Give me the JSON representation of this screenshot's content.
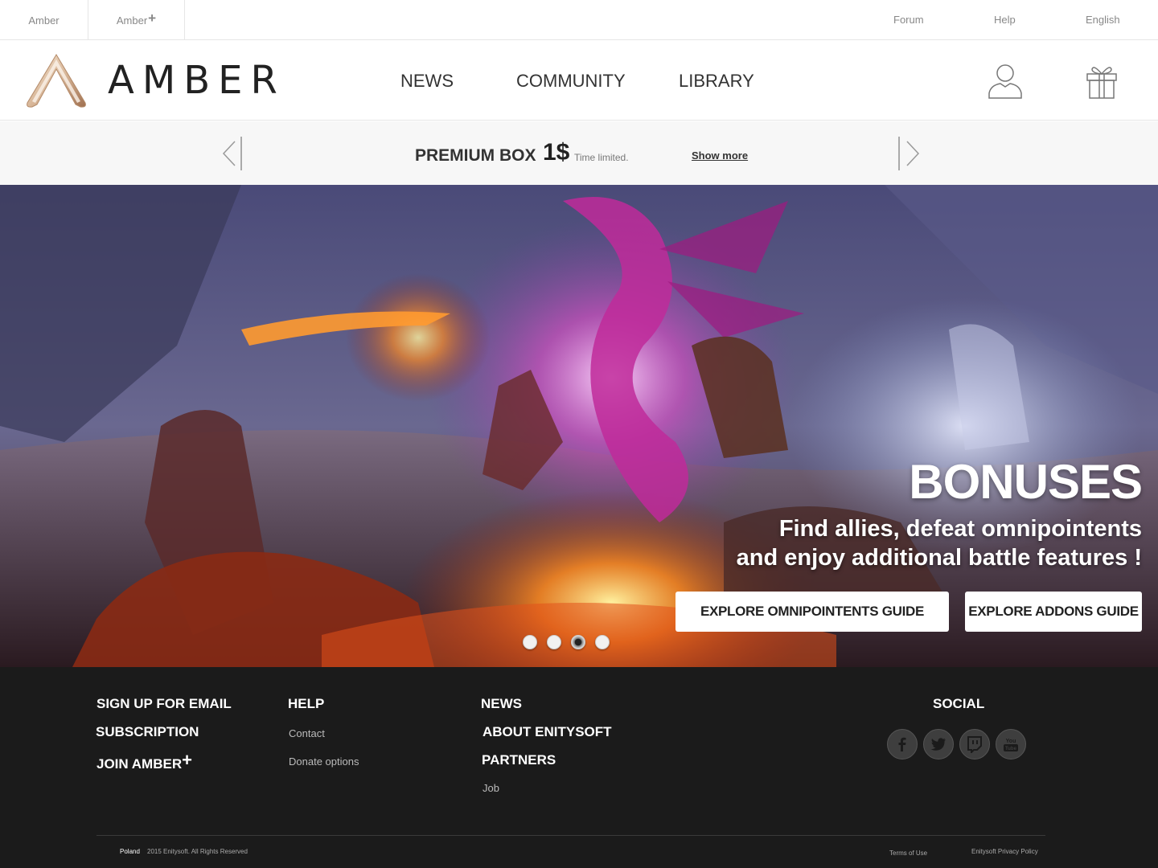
{
  "topbar": {
    "tab1": "Amber",
    "tab2": "Amber",
    "tab2_plus": "+",
    "links": [
      "Forum",
      "Help",
      "English"
    ]
  },
  "header": {
    "logo_text": "AMBER",
    "nav": [
      "NEWS",
      "COMMUNITY",
      "LIBRARY"
    ],
    "icons": [
      "user-icon",
      "gift-icon"
    ]
  },
  "promo": {
    "title": "PREMIUM BOX",
    "price": "1$",
    "subtitle": "Time limited.",
    "link": "Show more"
  },
  "hero": {
    "title": "BONUSES",
    "line1": "Find allies, defeat omnipointents",
    "line2": "and enjoy additional battle features !",
    "button1": "EXPLORE OMNIPOINTENTS GUIDE",
    "button2": "EXPLORE ADDONS GUIDE",
    "slides": 4,
    "active_slide": 3
  },
  "footer": {
    "col1": [
      "SIGN UP FOR EMAIL",
      "SUBSCRIPTION",
      "JOIN AMBER"
    ],
    "col1_plus": "+",
    "help_title": "HELP",
    "help_links": [
      "Contact",
      "Donate options"
    ],
    "col3": [
      "NEWS",
      "ABOUT ENITYSOFT",
      "PARTNERS"
    ],
    "col3_link": "Job",
    "social_title": "SOCIAL",
    "social_icons": [
      "facebook-icon",
      "twitter-icon",
      "twitch-icon",
      "youtube-icon"
    ],
    "country": "Poland",
    "copyright": "2015 Enitysoft. All Rights Reserved",
    "terms": "Terms of Use",
    "privacy": "Enitysoft Privacy Policy"
  },
  "colors": {
    "footer_bg": "#1b1b1b",
    "promo_bg": "#f7f7f7",
    "logo_accent": "#d9b89a"
  }
}
